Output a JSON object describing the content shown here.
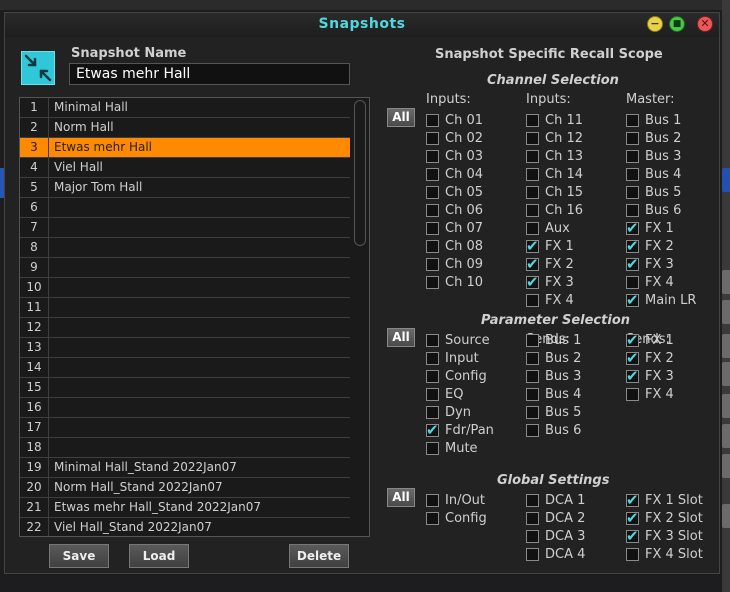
{
  "dialog": {
    "title": "Snapshots",
    "name_label": "Snapshot Name",
    "name_value": "Etwas mehr Hall"
  },
  "snapshots": [
    {
      "num": "1",
      "name": "Minimal Hall"
    },
    {
      "num": "2",
      "name": "Norm Hall"
    },
    {
      "num": "3",
      "name": "Etwas mehr Hall",
      "selected": true
    },
    {
      "num": "4",
      "name": "Viel Hall"
    },
    {
      "num": "5",
      "name": "Major Tom Hall"
    },
    {
      "num": "6",
      "name": ""
    },
    {
      "num": "7",
      "name": ""
    },
    {
      "num": "8",
      "name": ""
    },
    {
      "num": "9",
      "name": ""
    },
    {
      "num": "10",
      "name": ""
    },
    {
      "num": "11",
      "name": ""
    },
    {
      "num": "12",
      "name": ""
    },
    {
      "num": "13",
      "name": ""
    },
    {
      "num": "14",
      "name": ""
    },
    {
      "num": "15",
      "name": ""
    },
    {
      "num": "16",
      "name": ""
    },
    {
      "num": "17",
      "name": ""
    },
    {
      "num": "18",
      "name": ""
    },
    {
      "num": "19",
      "name": "Minimal Hall_Stand 2022Jan07"
    },
    {
      "num": "20",
      "name": "Norm Hall_Stand 2022Jan07"
    },
    {
      "num": "21",
      "name": "Etwas mehr Hall_Stand 2022Jan07"
    },
    {
      "num": "22",
      "name": "Viel Hall_Stand 2022Jan07"
    }
  ],
  "buttons": {
    "save": "Save",
    "load": "Load",
    "delete": "Delete",
    "all": "All"
  },
  "scope": {
    "title": "Snapshot Specific Recall Scope",
    "channel": {
      "title": "Channel Selection",
      "columns": [
        {
          "header": "Inputs:",
          "items": [
            {
              "label": "Ch 01",
              "checked": false
            },
            {
              "label": "Ch 02",
              "checked": false
            },
            {
              "label": "Ch 03",
              "checked": false
            },
            {
              "label": "Ch 04",
              "checked": false
            },
            {
              "label": "Ch 05",
              "checked": false
            },
            {
              "label": "Ch 06",
              "checked": false
            },
            {
              "label": "Ch 07",
              "checked": false
            },
            {
              "label": "Ch 08",
              "checked": false
            },
            {
              "label": "Ch 09",
              "checked": false
            },
            {
              "label": "Ch 10",
              "checked": false
            }
          ]
        },
        {
          "header": "Inputs:",
          "items": [
            {
              "label": "Ch 11",
              "checked": false
            },
            {
              "label": "Ch 12",
              "checked": false
            },
            {
              "label": "Ch 13",
              "checked": false
            },
            {
              "label": "Ch 14",
              "checked": false
            },
            {
              "label": "Ch 15",
              "checked": false
            },
            {
              "label": "Ch 16",
              "checked": false
            },
            {
              "label": "Aux",
              "checked": false
            },
            {
              "label": "FX 1",
              "checked": true
            },
            {
              "label": "FX 2",
              "checked": true
            },
            {
              "label": "FX 3",
              "checked": true
            },
            {
              "label": "FX 4",
              "checked": false
            }
          ]
        },
        {
          "header": "Master:",
          "items": [
            {
              "label": "Bus 1",
              "checked": false
            },
            {
              "label": "Bus 2",
              "checked": false
            },
            {
              "label": "Bus 3",
              "checked": false
            },
            {
              "label": "Bus 4",
              "checked": false
            },
            {
              "label": "Bus 5",
              "checked": false
            },
            {
              "label": "Bus 6",
              "checked": false
            },
            {
              "label": "FX 1",
              "checked": true
            },
            {
              "label": "FX 2",
              "checked": true
            },
            {
              "label": "FX 3",
              "checked": true
            },
            {
              "label": "FX 4",
              "checked": false
            },
            {
              "label": "Main LR",
              "checked": true
            }
          ]
        }
      ]
    },
    "parameter": {
      "title": "Parameter Selection",
      "columns": [
        {
          "header": "",
          "items": [
            {
              "label": "Source",
              "checked": false
            },
            {
              "label": "Input",
              "checked": false
            },
            {
              "label": "Config",
              "checked": false
            },
            {
              "label": "EQ",
              "checked": false
            },
            {
              "label": "Dyn",
              "checked": false
            },
            {
              "label": "Fdr/Pan",
              "checked": true
            },
            {
              "label": "Mute",
              "checked": false
            }
          ]
        },
        {
          "header": "Sends:",
          "items": [
            {
              "label": "Bus 1",
              "checked": false
            },
            {
              "label": "Bus 2",
              "checked": false
            },
            {
              "label": "Bus 3",
              "checked": false
            },
            {
              "label": "Bus 4",
              "checked": false
            },
            {
              "label": "Bus 5",
              "checked": false
            },
            {
              "label": "Bus 6",
              "checked": false
            }
          ]
        },
        {
          "header": "Sends:",
          "items": [
            {
              "label": "FX 1",
              "checked": true
            },
            {
              "label": "FX 2",
              "checked": true
            },
            {
              "label": "FX 3",
              "checked": true
            },
            {
              "label": "FX 4",
              "checked": false
            }
          ]
        }
      ]
    },
    "global": {
      "title": "Global Settings",
      "columns": [
        {
          "header": "",
          "items": [
            {
              "label": "In/Out",
              "checked": false
            },
            {
              "label": "Config",
              "checked": false
            }
          ]
        },
        {
          "header": "",
          "items": [
            {
              "label": "DCA 1",
              "checked": false
            },
            {
              "label": "DCA 2",
              "checked": false
            },
            {
              "label": "DCA 3",
              "checked": false
            },
            {
              "label": "DCA 4",
              "checked": false
            }
          ]
        },
        {
          "header": "",
          "items": [
            {
              "label": "FX 1 Slot",
              "checked": true
            },
            {
              "label": "FX 2 Slot",
              "checked": true
            },
            {
              "label": "FX 3 Slot",
              "checked": true
            },
            {
              "label": "FX 4 Slot",
              "checked": false
            }
          ]
        }
      ]
    }
  },
  "colors": {
    "accent": "#4fd8e0",
    "selection": "#ff8a00"
  }
}
